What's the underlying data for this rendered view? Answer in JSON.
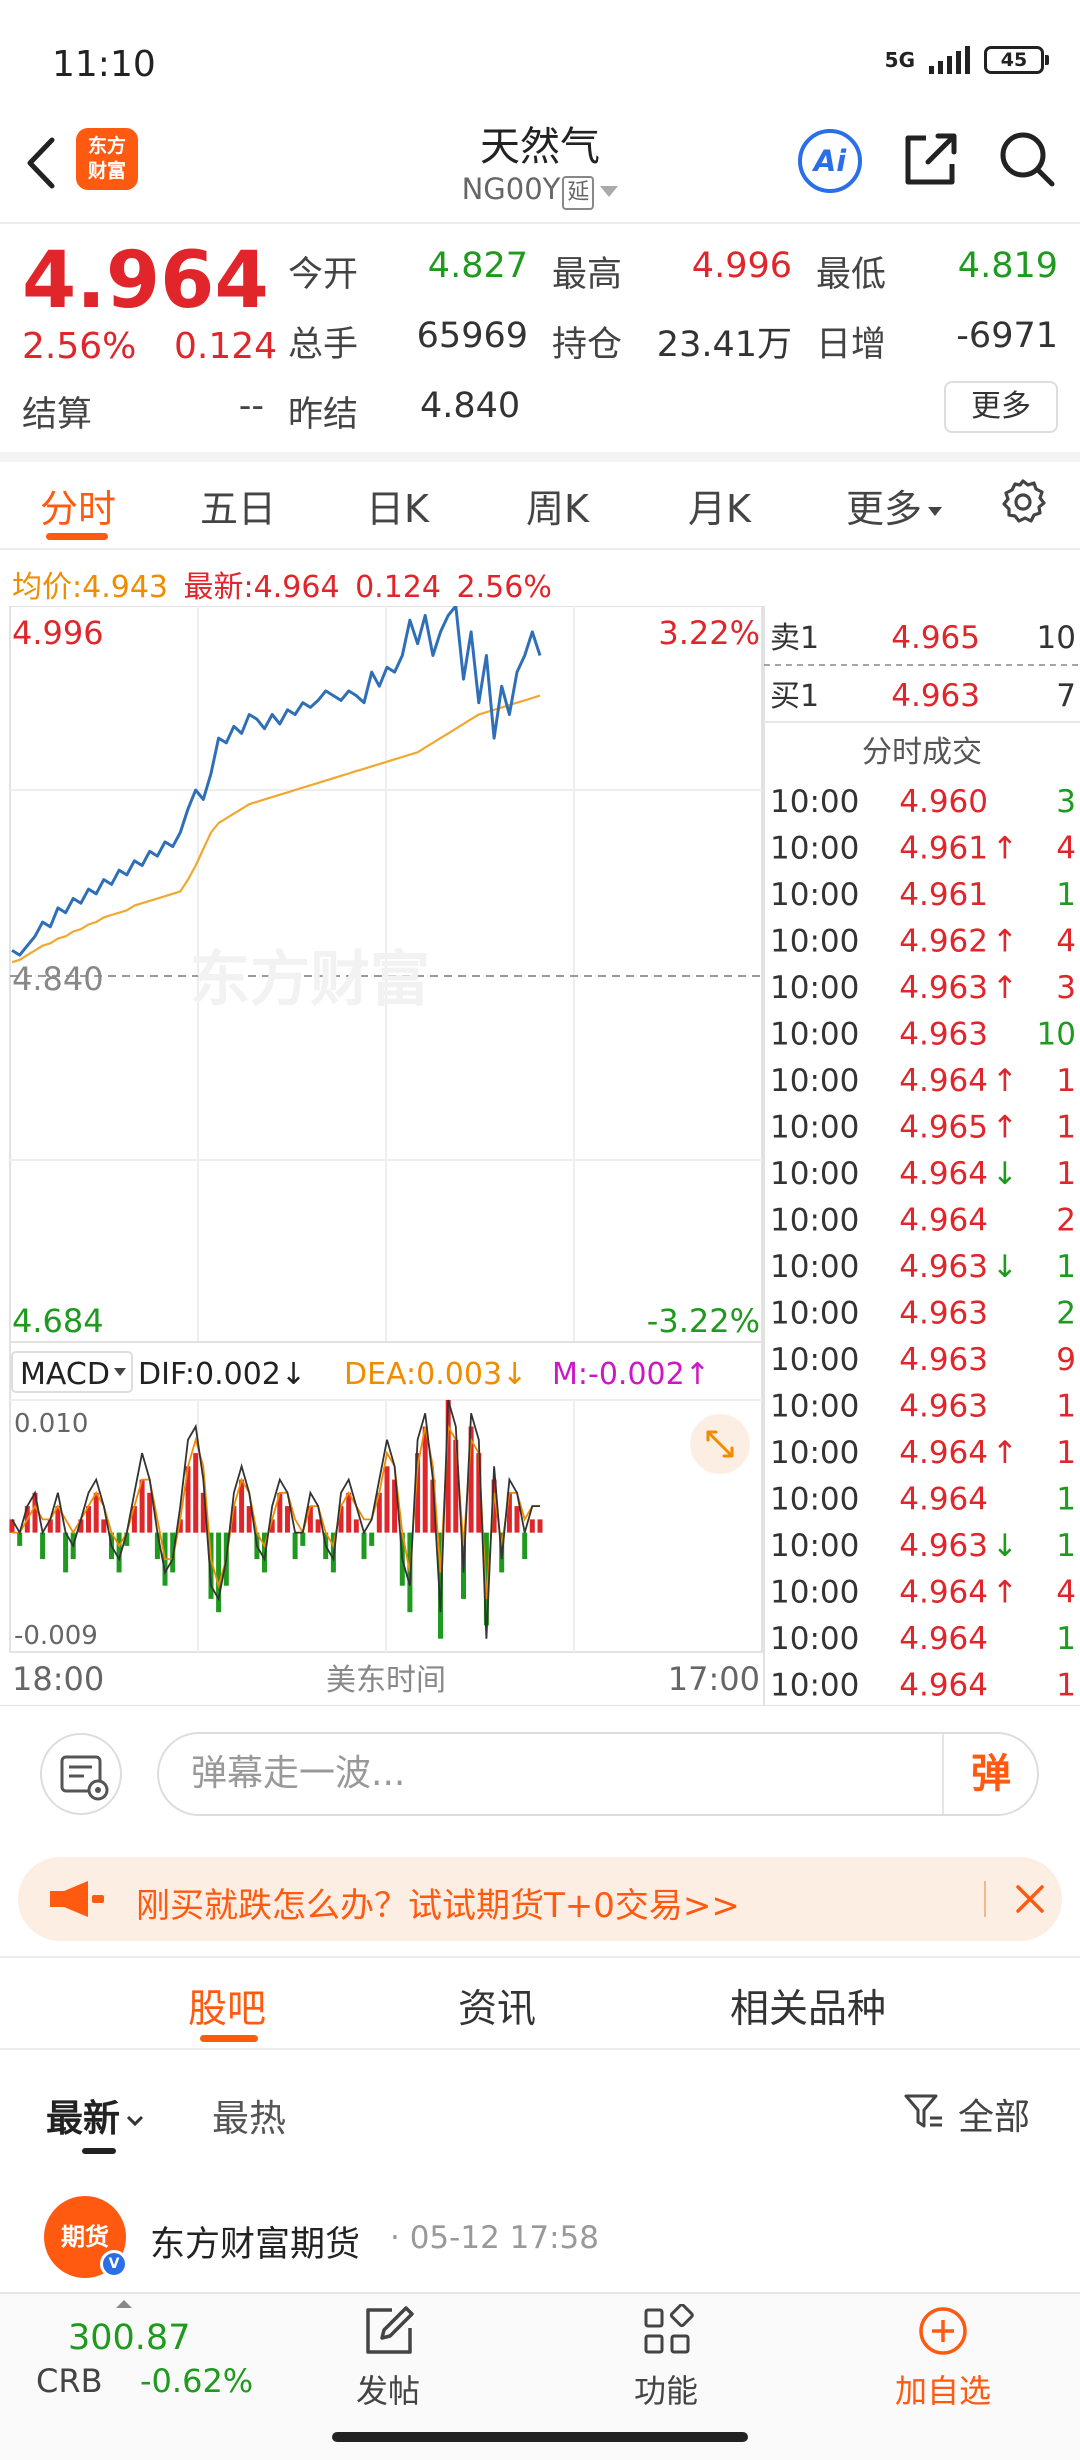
{
  "status_bar": {
    "time": "11:10",
    "network": "5G",
    "battery": "45"
  },
  "header": {
    "logo_text": "东方财富",
    "title": "天然气",
    "code": "NG00Y",
    "delay_tag": "延",
    "ai_label": "Ai"
  },
  "quote": {
    "price": "4.964",
    "change_pct": "2.56%",
    "change": "0.124",
    "settle_label": "结算",
    "settle_value": "--",
    "fields": [
      {
        "label": "今开",
        "value": "4.827",
        "color": "#1e9a1e"
      },
      {
        "label": "最高",
        "value": "4.996",
        "color": "#e0262b"
      },
      {
        "label": "最低",
        "value": "4.819",
        "color": "#1e9a1e"
      },
      {
        "label": "总手",
        "value": "65969",
        "color": "#333333"
      },
      {
        "label": "持仓",
        "value": "23.41万",
        "color": "#333333"
      },
      {
        "label": "日增",
        "value": "-6971",
        "color": "#333333"
      },
      {
        "label": "昨结",
        "value": "4.840",
        "color": "#333333"
      }
    ],
    "more_button": "更多"
  },
  "chart_tabs": [
    "分时",
    "五日",
    "日K",
    "周K",
    "月K",
    "更多"
  ],
  "info_line": {
    "avg_label": "均价:",
    "avg_value": "4.943",
    "latest_label": "最新:",
    "latest_value": "4.964",
    "change": "0.124",
    "change_pct": "2.56%"
  },
  "chart_data": {
    "type": "line",
    "y_max_label": "4.996",
    "y_mid_label": "4.840",
    "y_min_label": "4.684",
    "pct_max_label": "3.22%",
    "pct_min_label": "-3.22%",
    "ylim": [
      4.684,
      4.996
    ],
    "watermark": "东方财富",
    "price_series": [
      4.85,
      4.848,
      4.852,
      4.856,
      4.862,
      4.86,
      4.868,
      4.866,
      4.872,
      4.87,
      4.876,
      4.874,
      4.88,
      4.878,
      4.884,
      4.882,
      4.888,
      4.886,
      4.892,
      4.89,
      4.896,
      4.894,
      4.9,
      4.91,
      4.918,
      4.914,
      4.925,
      4.94,
      4.938,
      4.945,
      4.942,
      4.95,
      4.948,
      4.944,
      4.95,
      4.946,
      4.952,
      4.95,
      4.955,
      4.953,
      4.956,
      4.96,
      4.958,
      4.956,
      4.96,
      4.958,
      4.955,
      4.968,
      4.962,
      4.97,
      4.968,
      4.975,
      4.99,
      4.98,
      4.992,
      4.975,
      4.985,
      4.992,
      4.996,
      4.965,
      4.985,
      4.955,
      4.975,
      4.94,
      4.962,
      4.95,
      4.968,
      4.975,
      4.985,
      4.975
    ],
    "avg_series": [
      4.845,
      4.846,
      4.848,
      4.85,
      4.852,
      4.853,
      4.855,
      4.856,
      4.858,
      4.859,
      4.861,
      4.862,
      4.864,
      4.865,
      4.866,
      4.867,
      4.869,
      4.87,
      4.871,
      4.872,
      4.873,
      4.874,
      4.875,
      4.88,
      4.886,
      4.893,
      4.9,
      4.904,
      4.906,
      4.908,
      4.91,
      4.912,
      4.913,
      4.914,
      4.915,
      4.916,
      4.917,
      4.918,
      4.919,
      4.92,
      4.921,
      4.922,
      4.923,
      4.924,
      4.925,
      4.926,
      4.927,
      4.928,
      4.929,
      4.93,
      4.931,
      4.932,
      4.933,
      4.934,
      4.936,
      4.938,
      4.94,
      4.942,
      4.944,
      4.946,
      4.948,
      4.95,
      4.951,
      4.952,
      4.953,
      4.954,
      4.955,
      4.956,
      4.957,
      4.958
    ],
    "macd": {
      "label": "MACD",
      "dif": "DIF:0.002↓",
      "dea": "DEA:0.003↓",
      "m": "M:-0.002↑",
      "ymax_label": "0.010",
      "ymin_label": "-0.009",
      "ylim": [
        -0.009,
        0.01
      ],
      "hist": [
        0.001,
        -0.001,
        0.002,
        0.003,
        -0.002,
        0.001,
        0.002,
        -0.003,
        -0.002,
        0.001,
        0.002,
        0.003,
        0.001,
        -0.002,
        -0.003,
        -0.001,
        0.002,
        0.004,
        0.003,
        -0.002,
        -0.004,
        -0.003,
        0.001,
        0.005,
        0.006,
        0.003,
        -0.005,
        -0.006,
        -0.004,
        0.002,
        0.004,
        0.002,
        -0.002,
        -0.003,
        0.001,
        0.003,
        0.002,
        -0.002,
        -0.001,
        0.002,
        0.001,
        -0.002,
        -0.003,
        0.002,
        0.003,
        0.001,
        -0.002,
        -0.001,
        0.003,
        0.005,
        0.004,
        -0.004,
        -0.006,
        0.006,
        0.008,
        0.004,
        -0.008,
        0.01,
        0.007,
        -0.005,
        0.008,
        0.006,
        -0.007,
        0.004,
        -0.003,
        0.003,
        0.002,
        -0.002,
        0.001,
        0.001
      ],
      "dif_series": [
        0.001,
        0.0,
        0.002,
        0.003,
        0.0,
        0.001,
        0.003,
        0.0,
        -0.001,
        0.001,
        0.003,
        0.004,
        0.002,
        -0.001,
        -0.002,
        0.0,
        0.003,
        0.006,
        0.004,
        0.0,
        -0.003,
        -0.002,
        0.002,
        0.007,
        0.008,
        0.004,
        -0.004,
        -0.005,
        -0.002,
        0.003,
        0.005,
        0.003,
        -0.001,
        -0.002,
        0.002,
        0.004,
        0.003,
        0.0,
        0.0,
        0.003,
        0.002,
        -0.001,
        -0.002,
        0.003,
        0.004,
        0.002,
        0.0,
        0.001,
        0.004,
        0.007,
        0.005,
        -0.002,
        -0.004,
        0.007,
        0.009,
        0.004,
        -0.006,
        0.01,
        0.008,
        -0.003,
        0.009,
        0.007,
        -0.008,
        0.005,
        -0.002,
        0.004,
        0.003,
        0.0,
        0.002,
        0.002
      ],
      "dea_series": [
        0.0,
        0.0,
        0.001,
        0.002,
        0.001,
        0.001,
        0.002,
        0.001,
        0.0,
        0.001,
        0.002,
        0.003,
        0.002,
        0.0,
        -0.001,
        0.0,
        0.002,
        0.004,
        0.004,
        0.001,
        -0.002,
        -0.002,
        0.001,
        0.005,
        0.007,
        0.005,
        -0.002,
        -0.004,
        -0.002,
        0.002,
        0.004,
        0.003,
        0.0,
        -0.001,
        0.001,
        0.003,
        0.003,
        0.001,
        0.0,
        0.002,
        0.002,
        0.0,
        -0.001,
        0.002,
        0.003,
        0.002,
        0.001,
        0.001,
        0.003,
        0.006,
        0.005,
        0.0,
        -0.003,
        0.005,
        0.008,
        0.005,
        -0.003,
        0.008,
        0.007,
        -0.001,
        0.007,
        0.006,
        -0.005,
        0.003,
        -0.001,
        0.003,
        0.003,
        0.001,
        0.002,
        0.002
      ]
    },
    "x_start_label": "18:00",
    "x_mid_label": "美东时间",
    "x_end_label": "17:00"
  },
  "order_book": {
    "sell": {
      "label": "卖1",
      "price": "4.965",
      "volume": "10"
    },
    "buy": {
      "label": "买1",
      "price": "4.963",
      "volume": "7"
    }
  },
  "trades": {
    "title": "分时成交",
    "rows": [
      {
        "time": "10:00",
        "price": "4.960",
        "arrow": "",
        "volume": "3",
        "vol_color": "#1e9a1e"
      },
      {
        "time": "10:00",
        "price": "4.961",
        "arrow": "↑",
        "volume": "4",
        "vol_color": "#e0262b"
      },
      {
        "time": "10:00",
        "price": "4.961",
        "arrow": "",
        "volume": "1",
        "vol_color": "#1e9a1e"
      },
      {
        "time": "10:00",
        "price": "4.962",
        "arrow": "↑",
        "volume": "4",
        "vol_color": "#e0262b"
      },
      {
        "time": "10:00",
        "price": "4.963",
        "arrow": "↑",
        "volume": "3",
        "vol_color": "#e0262b"
      },
      {
        "time": "10:00",
        "price": "4.963",
        "arrow": "",
        "volume": "10",
        "vol_color": "#1e9a1e"
      },
      {
        "time": "10:00",
        "price": "4.964",
        "arrow": "↑",
        "volume": "1",
        "vol_color": "#e0262b"
      },
      {
        "time": "10:00",
        "price": "4.965",
        "arrow": "↑",
        "volume": "1",
        "vol_color": "#e0262b"
      },
      {
        "time": "10:00",
        "price": "4.964",
        "arrow": "↓",
        "volume": "1",
        "vol_color": "#e0262b"
      },
      {
        "time": "10:00",
        "price": "4.964",
        "arrow": "",
        "volume": "2",
        "vol_color": "#e0262b"
      },
      {
        "time": "10:00",
        "price": "4.963",
        "arrow": "↓",
        "volume": "1",
        "vol_color": "#1e9a1e"
      },
      {
        "time": "10:00",
        "price": "4.963",
        "arrow": "",
        "volume": "2",
        "vol_color": "#1e9a1e"
      },
      {
        "time": "10:00",
        "price": "4.963",
        "arrow": "",
        "volume": "9",
        "vol_color": "#e0262b"
      },
      {
        "time": "10:00",
        "price": "4.963",
        "arrow": "",
        "volume": "1",
        "vol_color": "#e0262b"
      },
      {
        "time": "10:00",
        "price": "4.964",
        "arrow": "↑",
        "volume": "1",
        "vol_color": "#e0262b"
      },
      {
        "time": "10:00",
        "price": "4.964",
        "arrow": "",
        "volume": "1",
        "vol_color": "#1e9a1e"
      },
      {
        "time": "10:00",
        "price": "4.963",
        "arrow": "↓",
        "volume": "1",
        "vol_color": "#1e9a1e"
      },
      {
        "time": "10:00",
        "price": "4.964",
        "arrow": "↑",
        "volume": "4",
        "vol_color": "#e0262b"
      },
      {
        "time": "10:00",
        "price": "4.964",
        "arrow": "",
        "volume": "1",
        "vol_color": "#1e9a1e"
      },
      {
        "time": "10:00",
        "price": "4.964",
        "arrow": "",
        "volume": "1",
        "vol_color": "#e0262b"
      }
    ]
  },
  "danmu": {
    "placeholder": "弹幕走一波...",
    "send_label": "弹"
  },
  "promo": {
    "text": "刚买就跌怎么办？试试期货T+0交易>>"
  },
  "content_tabs": [
    "股吧",
    "资讯",
    "相关品种"
  ],
  "sort": {
    "newest": "最新",
    "hottest": "最热",
    "filter": "全部"
  },
  "post": {
    "avatar_text": "期货",
    "author": "东方财富期货",
    "time": "· 05-12 17:58"
  },
  "bottom_nav": {
    "index_value": "300.87",
    "index_name": "CRB",
    "index_change": "-0.62%",
    "items": [
      "发帖",
      "功能",
      "加自选"
    ]
  },
  "colors": {
    "brand": "#ff5a10",
    "up": "#e0262b",
    "down": "#1e9a1e",
    "price_line": "#2f6fb8",
    "avg_line": "#f0a830"
  }
}
